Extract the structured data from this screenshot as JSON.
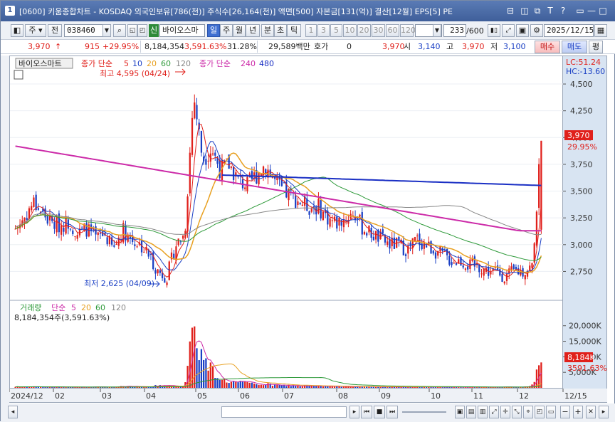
{
  "window": {
    "number": "1",
    "title": "[0600] 키움종합차트 - KOSDAQ 외국인보유[786(천)] 주식수[26,164(천)] 액면[500] 자본금[131(억)] 결산[12월] EPS[5] PE",
    "controls": [
      "⊟",
      "◫",
      "⧉",
      "T",
      "?",
      "▭",
      "—",
      "□",
      "✕"
    ]
  },
  "toolbar": {
    "type_label": "주",
    "prev_label": "전",
    "code_value": "038460",
    "new_tag": "신",
    "stock_name": "바이오스마",
    "periods": [
      "일",
      "주",
      "월",
      "년",
      "분",
      "초",
      "틱"
    ],
    "active_period": "일",
    "intervals": [
      "1",
      "3",
      "5",
      "10",
      "20",
      "30",
      "60",
      "120"
    ],
    "count_value": "233",
    "count_total": "/600",
    "date_value": "2025/12/15"
  },
  "quote": {
    "price": "3,970",
    "arrow": "↑",
    "change": "915",
    "change_pct": "+29.95%",
    "volume": "8,184,354",
    "volume_pct": "3,591.63%",
    "turnover": "31.28%",
    "trade_value": "29,589백만",
    "bid_label": "호가",
    "bid_value": "0",
    "price2": "3,970",
    "open_label": "시",
    "open": "3,140",
    "high_label": "고",
    "high": "3,970",
    "low_label": "저",
    "low": "3,100",
    "buy_label": "매수",
    "sell_label": "매도",
    "eval_label": "평"
  },
  "legend": {
    "stock_tag": "바이오스마트",
    "ma_label": "종가 단순",
    "ma_periods": [
      "5",
      "10",
      "20",
      "60",
      "120"
    ],
    "ma_label2": "종가 단순",
    "ma_periods2": [
      "240",
      "480"
    ],
    "high_annot": "최고 4,595 (04/24)",
    "low_annot": "최저 2,625 (04/09)",
    "lc": "LC:51.24",
    "hc": "HC:-13.60",
    "last_price_tag": "3,970",
    "last_pct_tag": "29.95%"
  },
  "volume_panel": {
    "title": "거래량",
    "ma_label": "단순",
    "ma_periods": [
      "5",
      "20",
      "60",
      "120"
    ],
    "value_text": "8,184,354주(3,591.63%)",
    "last_tag": "8,184K",
    "last_pct_tag": "3591.63%"
  },
  "colors": {
    "up": "#e0201b",
    "down": "#1a3fc4",
    "ma5": "#e0201b",
    "ma10": "#1a3fc4",
    "ma20": "#e8a020",
    "ma60": "#2e9a3a",
    "ma120": "#888888",
    "ma240": "#cc2aa8",
    "ma480": "#1a2fc4"
  },
  "chart_data": {
    "type": "candlestick",
    "price_axis": {
      "ylim": [
        2600,
        4600
      ],
      "ticks": [
        "4,500",
        "4,250",
        "4,000",
        "3,750",
        "3,500",
        "3,250",
        "3,000",
        "2,750"
      ]
    },
    "volume_axis": {
      "ylim": [
        0,
        22000
      ],
      "ticks": [
        "20,000K",
        "15,000K",
        "10,000K",
        "5,000K"
      ]
    },
    "x_ticks": [
      "2024/12",
      "02",
      "03",
      "04",
      "05",
      "06",
      "07",
      "08",
      "09",
      "10",
      "11",
      "12",
      "12/15"
    ],
    "close_path": [
      3150,
      3250,
      3400,
      3300,
      3200,
      3180,
      3220,
      3100,
      3150,
      3050,
      3100,
      2950,
      3150,
      3050,
      3000,
      2900,
      2750,
      2700,
      3000,
      3100,
      4400,
      3800,
      3900,
      3700,
      3750,
      3600,
      3550,
      3650,
      3750,
      3600,
      3500,
      3450,
      3400,
      3350,
      3350,
      3250,
      3200,
      3250,
      3300,
      3150,
      3100,
      3050,
      3000,
      3000,
      2950,
      3050,
      3000,
      2950,
      2900,
      2850,
      2850,
      2800,
      2800,
      2750,
      2750,
      2700,
      2750,
      2750,
      2800,
      3970
    ],
    "volume_path": [
      400,
      300,
      350,
      300,
      250,
      300,
      200,
      250,
      200,
      300,
      250,
      250,
      600,
      400,
      350,
      300,
      900,
      700,
      500,
      800,
      21000,
      9000,
      6000,
      3000,
      2000,
      1800,
      1500,
      1200,
      1200,
      900,
      700,
      800,
      600,
      600,
      500,
      500,
      450,
      500,
      450,
      400,
      350,
      350,
      300,
      300,
      300,
      350,
      300,
      300,
      250,
      250,
      250,
      250,
      250,
      200,
      200,
      250,
      250,
      300,
      800,
      8184
    ]
  }
}
